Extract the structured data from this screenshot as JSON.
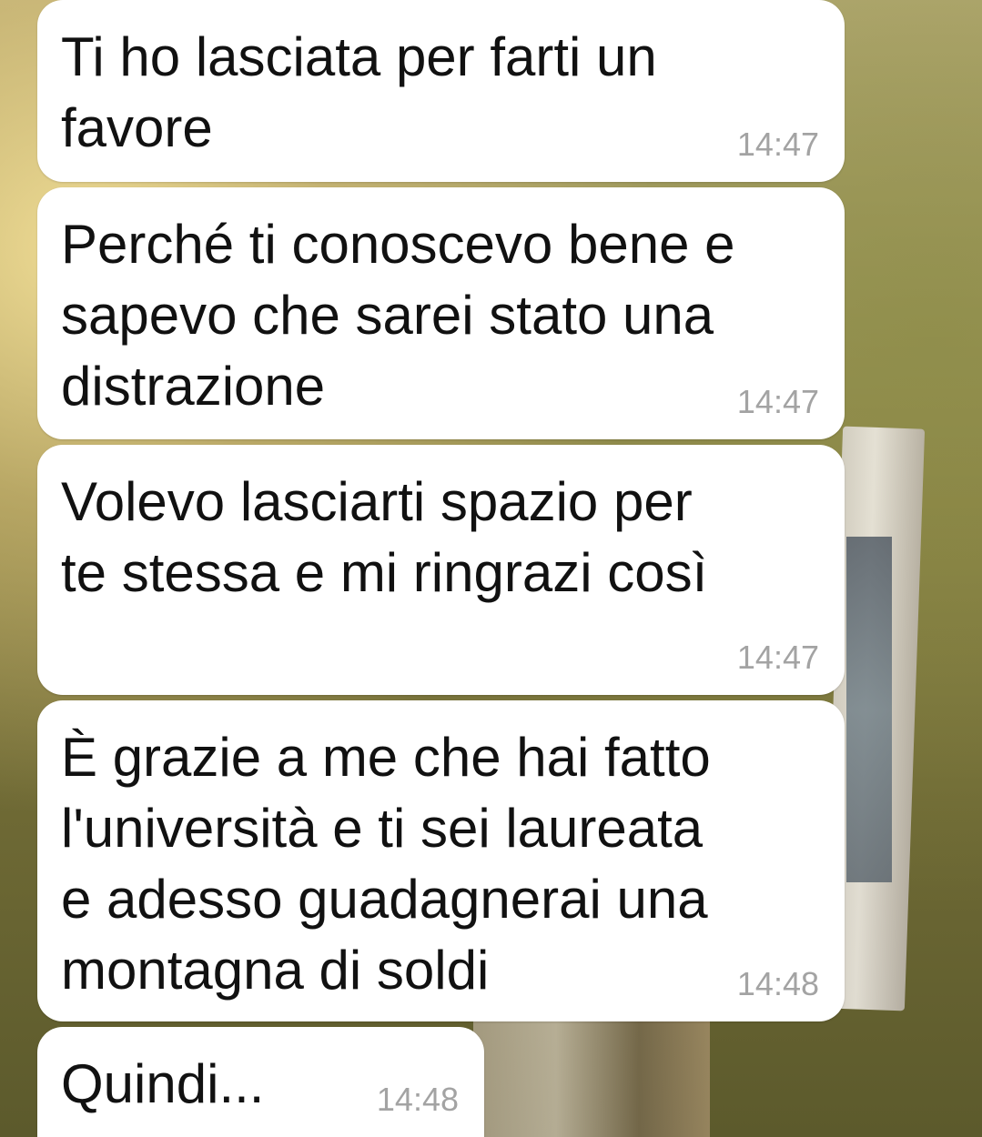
{
  "messages": [
    {
      "text": "Ti ho lasciata per farti un\nfavore",
      "time": "14:47"
    },
    {
      "text": "Perché ti conoscevo bene e\nsapevo che sarei stato una\ndistrazione",
      "time": "14:47"
    },
    {
      "text": "Volevo lasciarti spazio per\nte stessa e mi ringrazi così",
      "time": "14:47"
    },
    {
      "text": "È grazie a me che hai fatto\nl'università e ti sei laureata\ne adesso guadagnerai una\nmontagna di soldi",
      "time": "14:48"
    },
    {
      "text": "Quindi...",
      "time": "14:48"
    }
  ],
  "colors": {
    "bubble": "#ffffff",
    "text": "#111111",
    "time": "#a3a3a3"
  }
}
